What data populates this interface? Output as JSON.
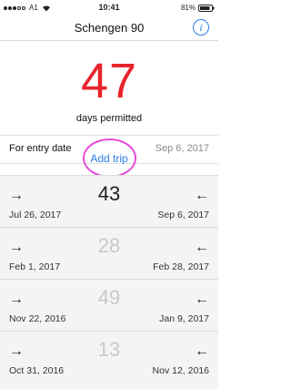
{
  "status": {
    "carrier": "A1",
    "time": "10:41",
    "battery": "81%"
  },
  "nav": {
    "title": "Schengen 90",
    "info_icon": "i"
  },
  "summary": {
    "days_count": "47",
    "days_label": "days permitted"
  },
  "entry": {
    "label": "For entry date",
    "value": "Sep 6, 2017"
  },
  "actions": {
    "add_trip_label": "Add trip"
  },
  "trips": [
    {
      "days": "43",
      "from": "Jul 26, 2017",
      "to": "Sep 6, 2017"
    },
    {
      "days": "28",
      "from": "Feb 1, 2017",
      "to": "Feb 28, 2017"
    },
    {
      "days": "49",
      "from": "Nov 22, 2016",
      "to": "Jan 9, 2017"
    },
    {
      "days": "13",
      "from": "Oct 31, 2016",
      "to": "Nov 12, 2016"
    }
  ],
  "icons": {
    "arrow_in": "→",
    "arrow_out": "←"
  },
  "colors": {
    "accent": "#2b7de9",
    "count_red": "#e8242b",
    "highlight_ring": "#e64bd8"
  }
}
